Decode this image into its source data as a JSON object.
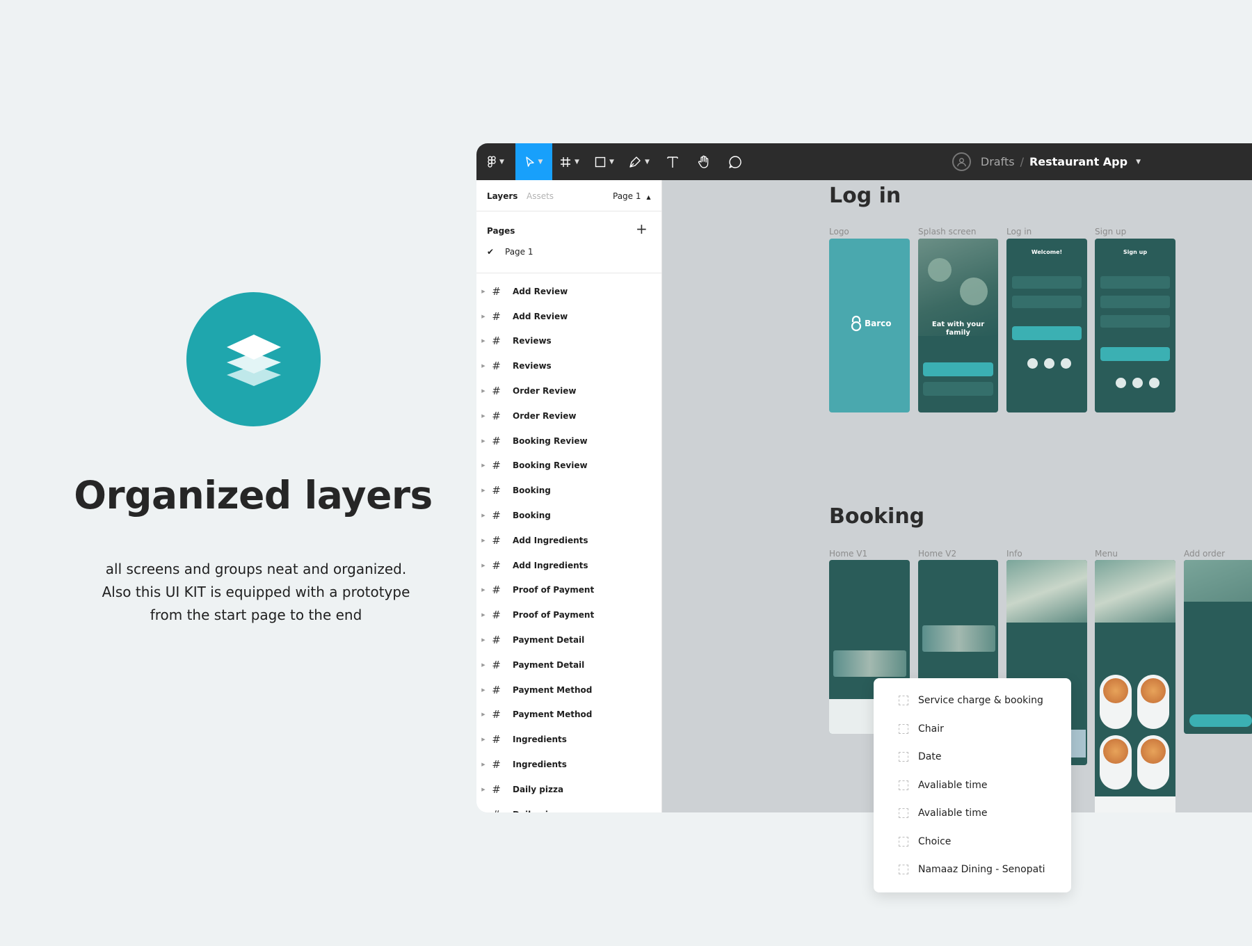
{
  "hero": {
    "icon": "layers-icon",
    "title": "Organized layers",
    "description": [
      "all screens and groups neat and organized.",
      "Also this UI KIT is equipped with a prototype",
      "from the start page to the end"
    ]
  },
  "toolbar": {
    "breadcrumb_drafts": "Drafts",
    "breadcrumb_sep": "/",
    "project_name": "Restaurant App"
  },
  "panel": {
    "tab_layers": "Layers",
    "tab_assets": "Assets",
    "page_selector": "Page 1",
    "pages_heading": "Pages",
    "current_page": "Page 1",
    "layers": [
      "Add Review",
      "Add Review",
      "Reviews",
      "Reviews",
      "Order Review",
      "Order Review",
      "Booking Review",
      "Booking Review",
      "Booking",
      "Booking",
      "Add Ingredients",
      "Add Ingredients",
      "Proof of Payment",
      "Proof of Payment",
      "Payment Detail",
      "Payment Detail",
      "Payment Method",
      "Payment Method",
      "Ingredients",
      "Ingredients",
      "Daily pizza",
      "Daily pizza"
    ]
  },
  "canvas": {
    "section_login": "Log in",
    "login_frames": [
      "Logo",
      "Splash screen",
      "Log in",
      "Sign up"
    ],
    "section_booking": "Booking",
    "booking_frames": [
      "Home V1",
      "Home V2",
      "Info",
      "Menu",
      "Add order"
    ],
    "logo_brand": "Barco",
    "splash_heading": "Eat with your family",
    "login_heading": "Welcome!",
    "signup_heading": "Sign up"
  },
  "dropdown": {
    "items": [
      "Service charge & booking",
      "Chair",
      "Date",
      "Avaliable time",
      "Avaliable time",
      "Choice",
      "Namaaz Dining - Senopati"
    ]
  },
  "colors": {
    "accent": "#1fa6ad",
    "figma_blue": "#18a0fb",
    "toolbar": "#2c2c2c",
    "phone_dark": "#2a5c59",
    "phone_teal": "#4aa8ae"
  }
}
